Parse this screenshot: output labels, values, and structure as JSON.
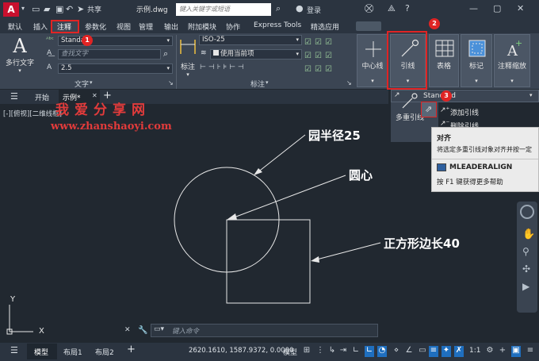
{
  "titlebar": {
    "logo": "A",
    "share": "共享",
    "document": "示例.dwg",
    "search_placeholder": "键入关键字或短语",
    "login": "登录"
  },
  "ribbon_tabs": [
    "默认",
    "插入",
    "注释",
    "参数化",
    "视图",
    "管理",
    "输出",
    "附加模块",
    "协作",
    "Express Tools",
    "精选应用"
  ],
  "text_panel": {
    "big_button": "多行文字",
    "style": "Standard",
    "find_placeholder": "查找文字",
    "height": "2.5",
    "label": "文字"
  },
  "dim_panel": {
    "big_button": "标注",
    "style": "ISO-25",
    "layer": "使用当前项",
    "label": "标注"
  },
  "tools": {
    "centerline": "中心线",
    "leader": "引线",
    "table": "表格",
    "markup": "标记",
    "annoscale": "注释缩放"
  },
  "file_tabs": {
    "start": "开始",
    "drawing": "示例*",
    "add": "+"
  },
  "leader_dropdown": {
    "style": "Standard",
    "big_button": "多重引线",
    "add": "添加引线",
    "remove": "删除引线"
  },
  "viewport_label": "[-][俯视][二维线框]",
  "watermark": {
    "cn": "我爱分享网",
    "url": "www.zhanshaoyi.com"
  },
  "annotations": {
    "radius": "园半径25",
    "center": "圆心",
    "square": "正方形边长40"
  },
  "tooltip": {
    "title": "对齐",
    "desc": "将选定多重引线对象对齐并按一定",
    "command": "MLEADERALIGN",
    "help": "按 F1 键获得更多帮助"
  },
  "badges": [
    "1",
    "2",
    "3"
  ],
  "command_placeholder": "键入命令",
  "axis": {
    "y": "Y",
    "x": "X"
  },
  "status": {
    "model_tab": "模型",
    "layout1": "布局1",
    "layout2": "布局2",
    "coords": "2620.1610, 1587.9372, 0.0000",
    "model": "模型",
    "scale": "1:1"
  },
  "colors": {
    "accent_red": "#e02424",
    "bg": "#212830",
    "ribbon": "#3b4553",
    "active_tab": "#1f6fbf"
  }
}
